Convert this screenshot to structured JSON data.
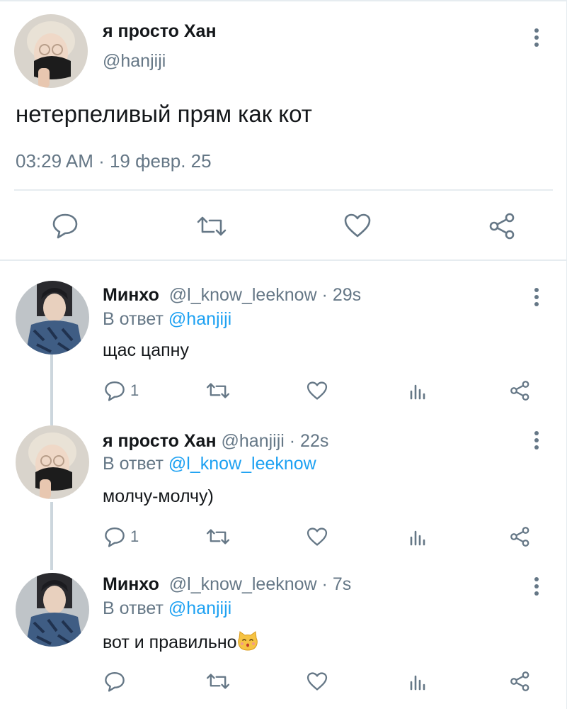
{
  "main_tweet": {
    "display_name": "я просто Хан",
    "handle": "@hanjiji",
    "text": "нетерпеливый прям как кот",
    "timestamp": "03:29 AM · 19 февр. 25",
    "actions": [
      "reply-icon",
      "retweet-icon",
      "like-icon",
      "share-icon"
    ]
  },
  "replies": [
    {
      "display_name": "Минхо",
      "handle": "@l_know_leeknow",
      "time": "29s",
      "reply_prefix": "В ответ",
      "reply_to": "@hanjiji",
      "text": "щас цапну",
      "reply_count": "1"
    },
    {
      "display_name": "я просто Хан",
      "handle": "@hanjiji",
      "time": "22s",
      "reply_prefix": "В ответ",
      "reply_to": "@l_know_leeknow",
      "text": "молчу-молчу)",
      "reply_count": "1"
    },
    {
      "display_name": "Минхо",
      "handle": "@l_know_leeknow",
      "time": "7s",
      "reply_prefix": "В ответ",
      "reply_to": "@hanjiji",
      "text": "вот и правильно",
      "emoji": "kissing-cat-emoji",
      "reply_count": ""
    }
  ],
  "colors": {
    "text": "#14171a",
    "secondary": "#657786",
    "mention": "#1da1f2",
    "divider": "#e6ecf0",
    "thread_line": "#ccd6dd"
  }
}
